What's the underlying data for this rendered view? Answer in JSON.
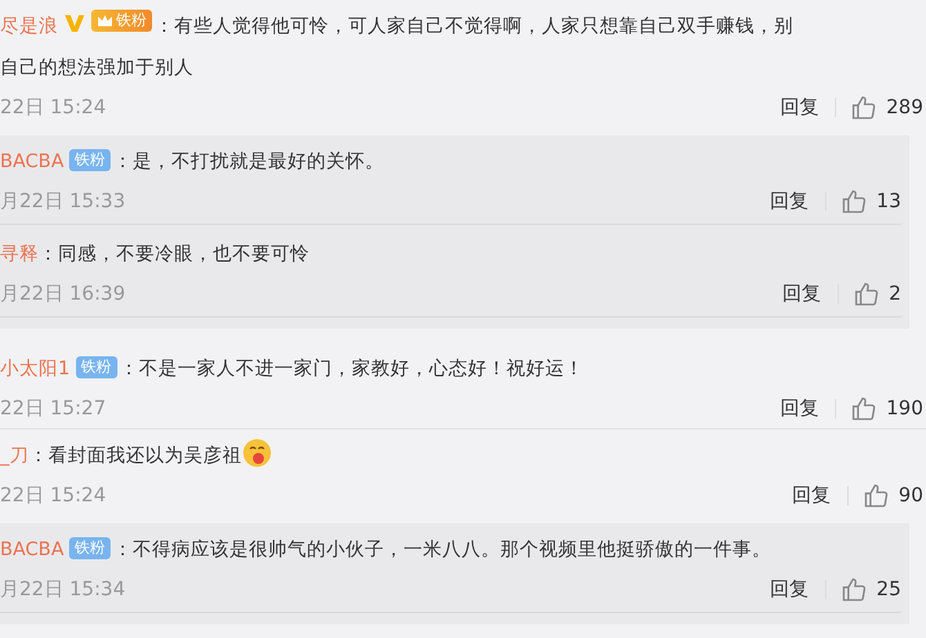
{
  "comments": [
    {
      "name": "尽是浪",
      "verified": true,
      "badge": {
        "label": "铁粉",
        "kind": "gold"
      },
      "text_lines": [
        "：有些人觉得他可怜，可人家自己不觉得啊，人家只想靠自己双手赚钱，别",
        "自己的想法强加于别人"
      ],
      "emoji": false,
      "time": "22日 15:24",
      "reply": "回复",
      "likes": "289",
      "replies": [
        {
          "name": "BACBA",
          "badge": {
            "label": "铁粉",
            "kind": "blue"
          },
          "text_lines": [
            "：是，不打扰就是最好的关怀。"
          ],
          "time": "月22日 15:33",
          "reply": "回复",
          "likes": "13"
        },
        {
          "name": "寻释",
          "text_lines": [
            "：同感，不要冷眼，也不要可怜"
          ],
          "time": "月22日 16:39",
          "reply": "回复",
          "likes": "2"
        }
      ]
    },
    {
      "name": "小太阳1",
      "verified": false,
      "badge": {
        "label": "铁粉",
        "kind": "blue"
      },
      "text_lines": [
        "：不是一家人不进一家门，家教好，心态好！祝好运！"
      ],
      "emoji": false,
      "time": "22日 15:27",
      "reply": "回复",
      "likes": "190"
    },
    {
      "name": "_刀",
      "verified": false,
      "text_lines": [
        "：看封面我还以为吴彦祖"
      ],
      "emoji": true,
      "time": "22日 15:24",
      "reply": "回复",
      "likes": "90",
      "replies": [
        {
          "name": "BACBA",
          "badge": {
            "label": "铁粉",
            "kind": "blue"
          },
          "text_lines": [
            "：不得病应该是很帅气的小伙子，一米八八。那个视频里他挺骄傲的一件事。"
          ],
          "time": "月22日 15:34",
          "reply": "回复",
          "likes": "25"
        }
      ]
    }
  ]
}
